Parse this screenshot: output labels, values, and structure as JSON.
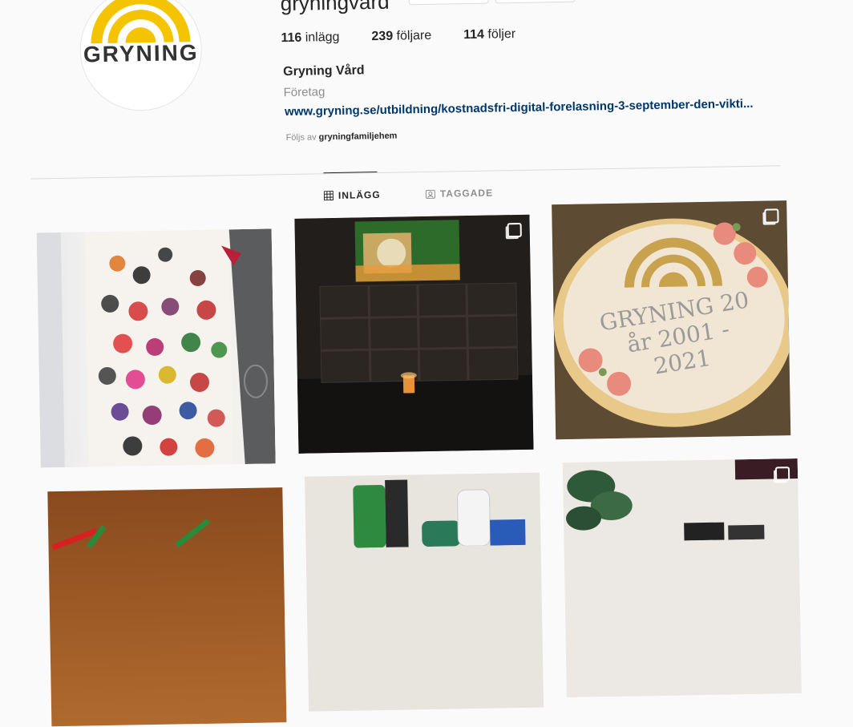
{
  "profile": {
    "username": "gryningvard",
    "logo_text": "GRYNING",
    "stats": [
      {
        "count": "116",
        "label": "inlägg"
      },
      {
        "count": "239",
        "label": "följare"
      },
      {
        "count": "114",
        "label": "följer"
      }
    ],
    "display_name": "Gryning Vård",
    "category": "Företag",
    "link": "www.gryning.se/utbildning/kostnadsfri-digital-forelasning-3-september-den-vikti...",
    "followed_by_prefix": "Följs av",
    "followed_by_user": "gryningfamiljehem"
  },
  "tabs": [
    {
      "label": "INLÄGG",
      "icon": "grid-icon",
      "active": true
    },
    {
      "label": "TAGGADE",
      "icon": "tagged-icon",
      "active": false
    }
  ],
  "posts": [
    {
      "id": "handprints-wall",
      "multi": false
    },
    {
      "id": "tv-candles-room",
      "multi": true
    },
    {
      "id": "anniversary-cake",
      "multi": true,
      "cake_text": "GRYNING 20 år 2001 - 2021"
    },
    {
      "id": "markers-table",
      "multi": false
    },
    {
      "id": "toiletries",
      "multi": false
    },
    {
      "id": "plant-books",
      "multi": true
    }
  ],
  "colors": {
    "accent": "#f5c400",
    "link": "#00376b",
    "muted": "#8e8e8e"
  }
}
